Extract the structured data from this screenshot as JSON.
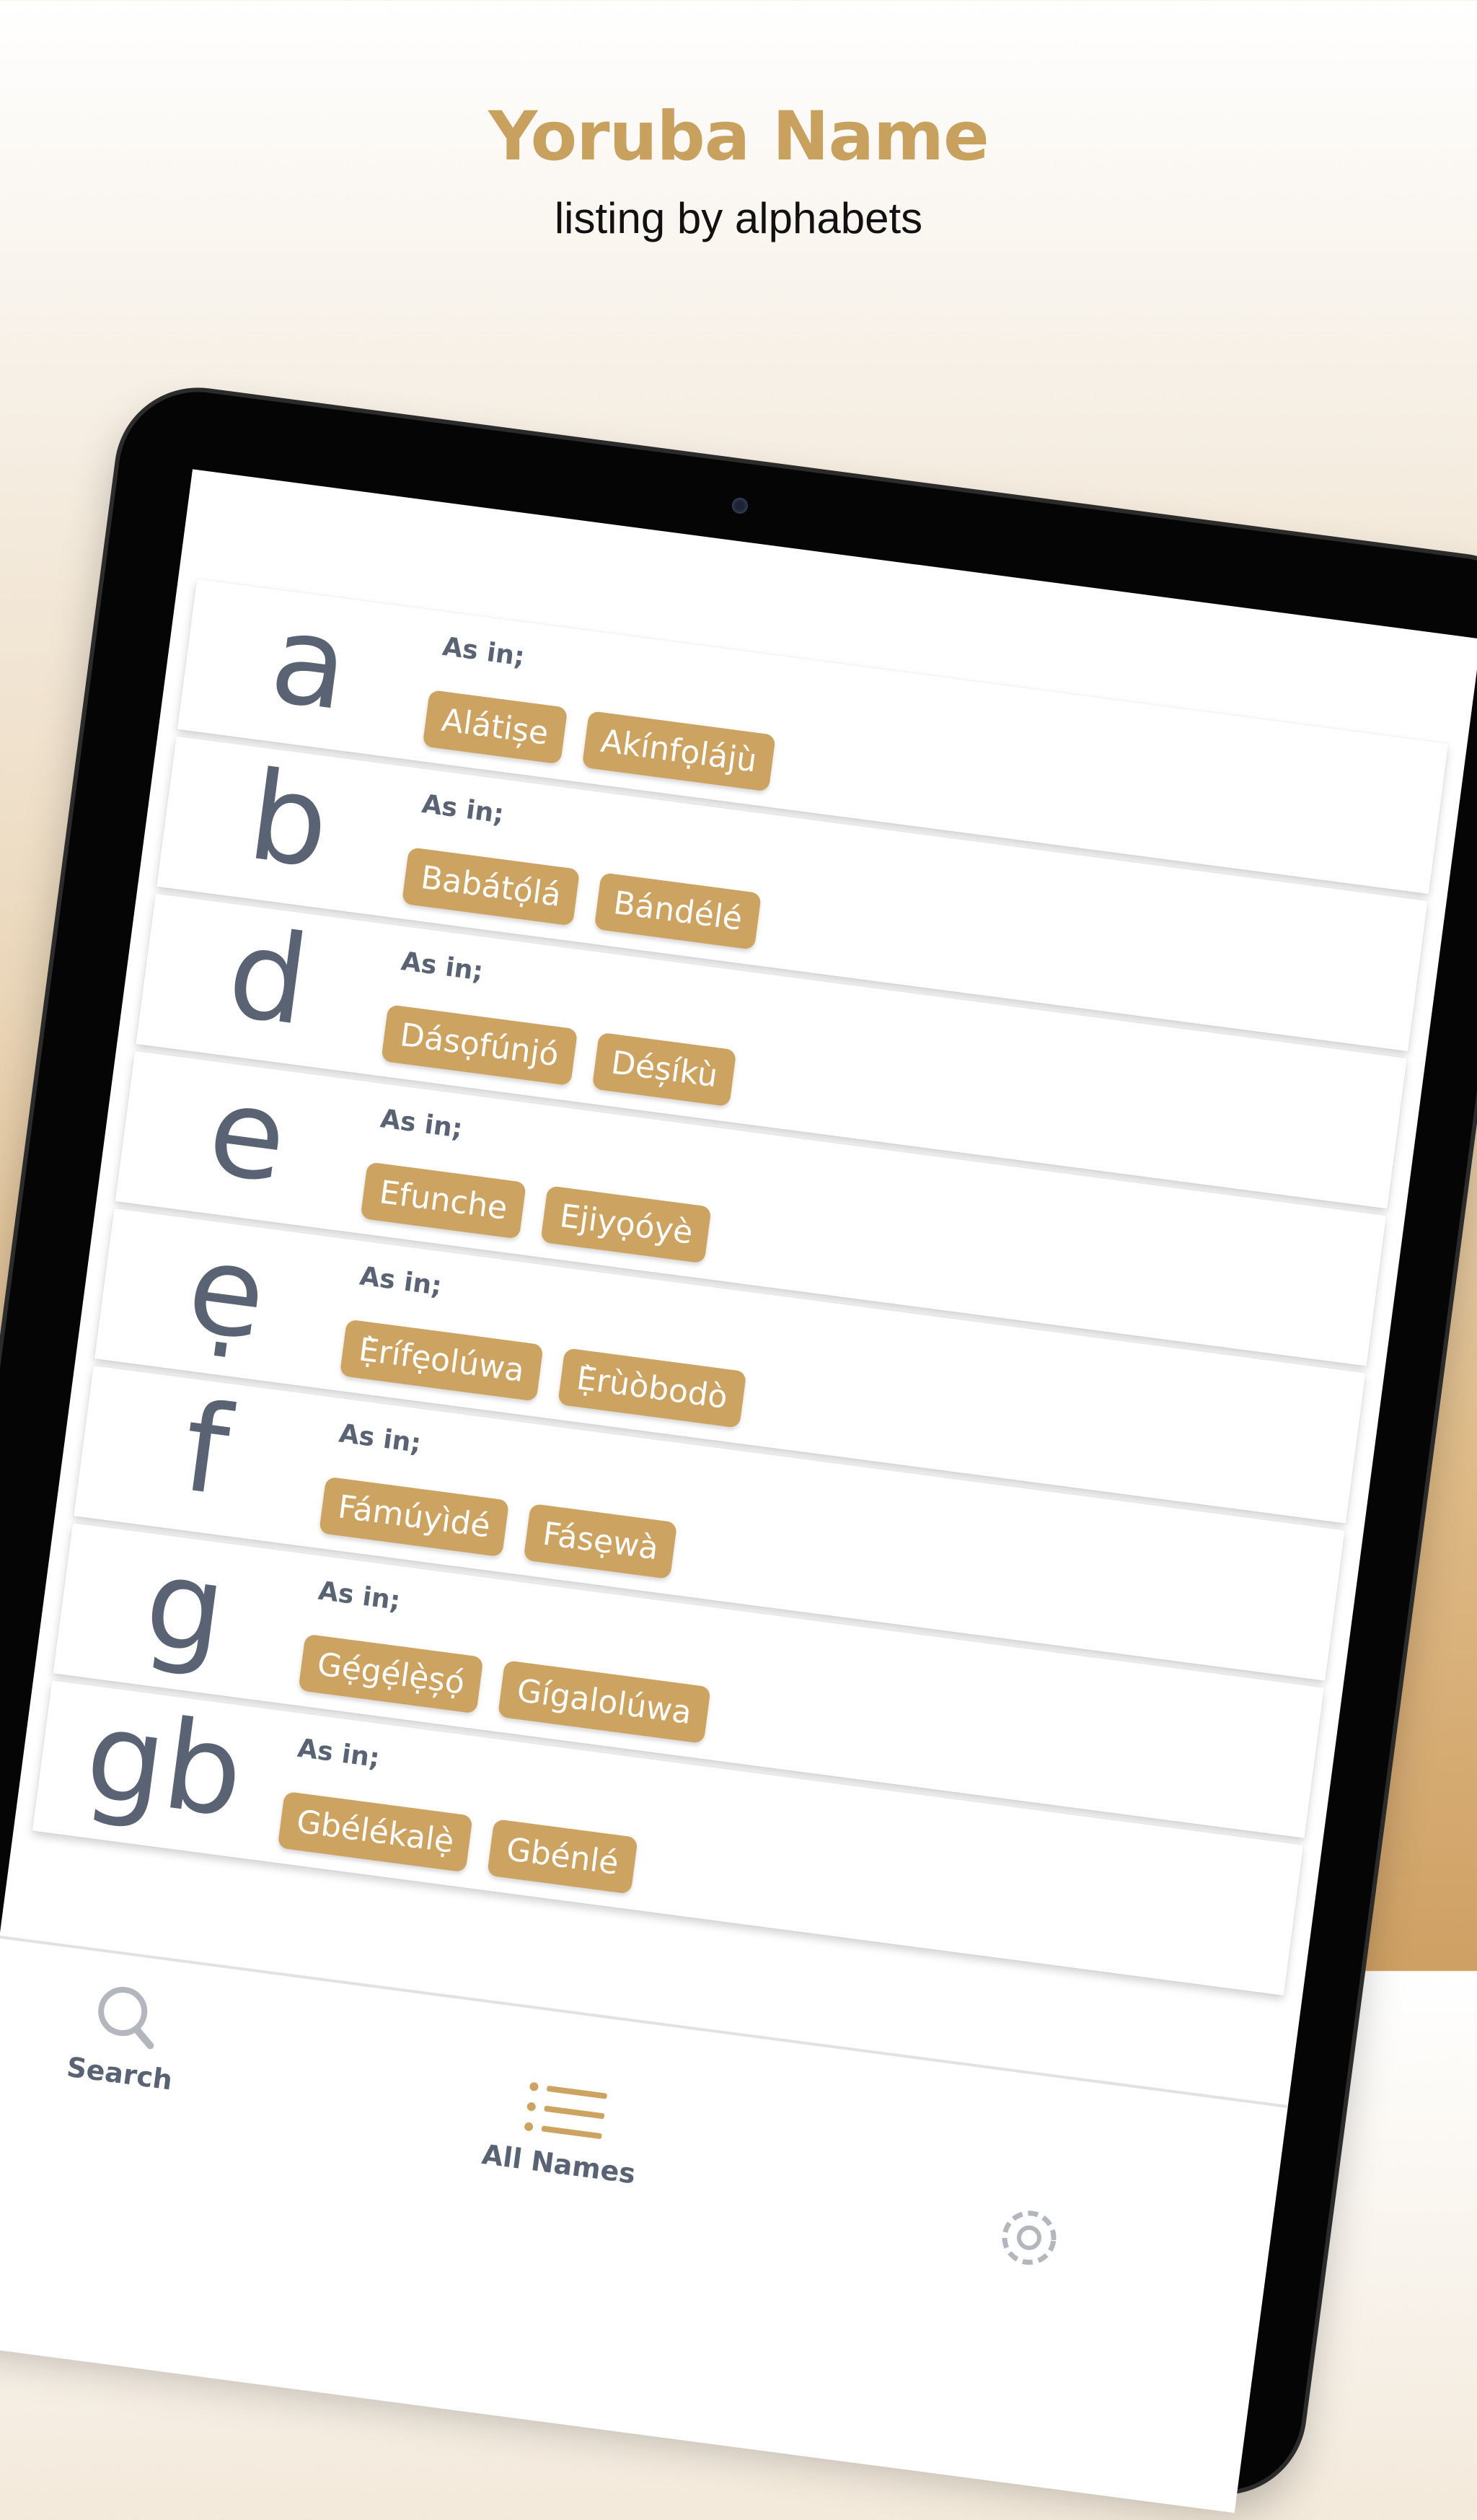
{
  "header": {
    "title": "Yoruba Name",
    "subtitle": "listing by alphabets"
  },
  "as_in_label": "As in;",
  "alphabet_rows": [
    {
      "letter": "a",
      "examples": [
        "Alátișe",
        "Akínfọlájù"
      ]
    },
    {
      "letter": "b",
      "examples": [
        "Babátọ́lá",
        "Bándélé"
      ]
    },
    {
      "letter": "d",
      "examples": [
        "Dásọfúnjó",
        "Déșíkù"
      ]
    },
    {
      "letter": "e",
      "examples": [
        "Efunche",
        "Ejiyọóyè"
      ]
    },
    {
      "letter": "ẹ",
      "examples": [
        "Ẹ̀rífẹolúwa",
        "Ẹ̀rùòbodò"
      ]
    },
    {
      "letter": "f",
      "examples": [
        "Fámúyìdé",
        "Fásẹwà"
      ]
    },
    {
      "letter": "g",
      "examples": [
        "Gẹ́gẹ́lẹ̀șọ́",
        "Gígalolúwa"
      ]
    },
    {
      "letter": "gb",
      "examples": [
        "Gbélékalẹ̀",
        "Gbénlé"
      ]
    }
  ],
  "tabs": {
    "search": "Search",
    "all_names": "All Names"
  },
  "icons": {
    "search": "search-icon",
    "all_names": "list-icon",
    "settings": "gear-icon"
  },
  "colors": {
    "accent": "#cda362",
    "title": "#c9a15f",
    "letter": "#5a6374"
  }
}
